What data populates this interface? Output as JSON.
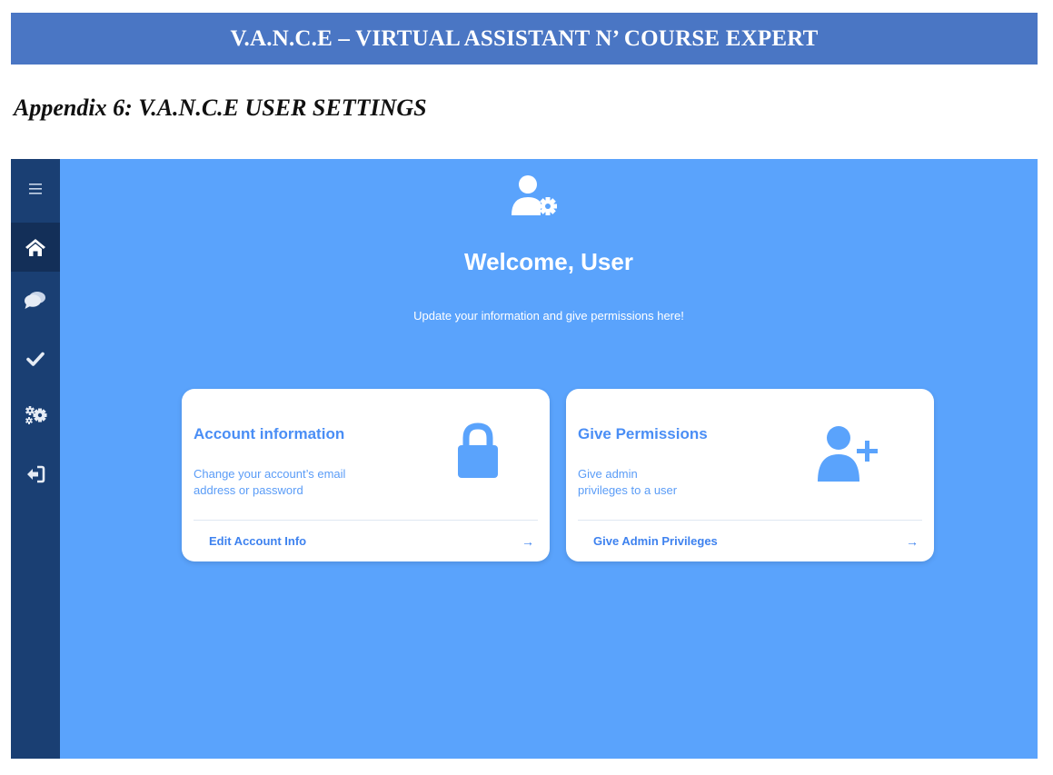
{
  "document": {
    "header_title": "V.A.N.C.E – VIRTUAL ASSISTANT N’ COURSE EXPERT",
    "appendix_title": "Appendix 6: V.A.N.C.E USER SETTINGS"
  },
  "sidebar": {
    "items": [
      {
        "icon": "menu-icon"
      },
      {
        "icon": "home-icon",
        "active": true
      },
      {
        "icon": "chat-icon"
      },
      {
        "icon": "check-icon"
      },
      {
        "icon": "settings-icon"
      },
      {
        "icon": "logout-icon"
      }
    ]
  },
  "main": {
    "hero_icon": "user-settings-icon",
    "welcome": "Welcome, User",
    "subtitle": "Update your information and give permissions here!"
  },
  "cards": [
    {
      "title": "Account information",
      "description": "Change your account’s email address or password",
      "link_label": "Edit Account Info",
      "arrow": "→",
      "icon": "lock-icon"
    },
    {
      "title": "Give Permissions",
      "description": "Give admin privileges to a user",
      "link_label": "Give Admin Privileges",
      "arrow": "→",
      "icon": "add-user-icon"
    }
  ],
  "colors": {
    "header_bar": "#4a76c4",
    "app_background": "#5aa3fc",
    "sidebar": "#1a3f73",
    "card_accent": "#4a8ef5"
  }
}
